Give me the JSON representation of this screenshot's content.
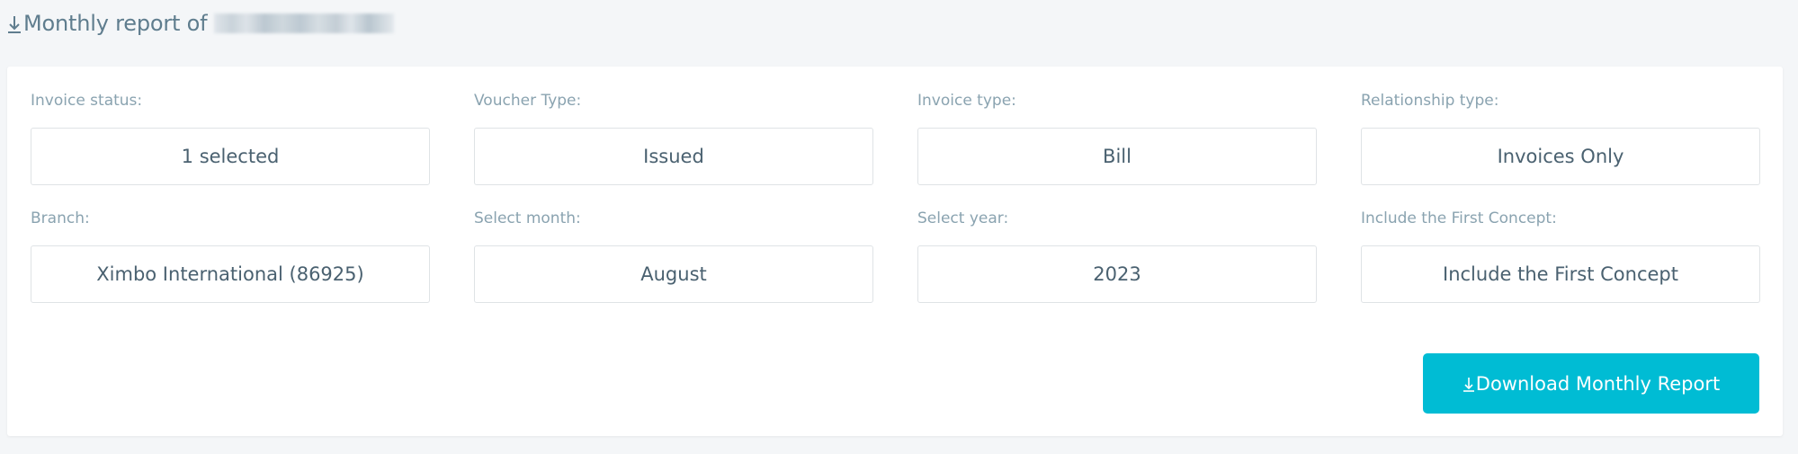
{
  "header": {
    "title": "Monthly report of",
    "title_icon": "download-icon",
    "redacted_name": ""
  },
  "filters": [
    {
      "label": "Invoice status:",
      "value": "1 selected"
    },
    {
      "label": "Voucher Type:",
      "value": "Issued"
    },
    {
      "label": "Invoice type:",
      "value": "Bill"
    },
    {
      "label": "Relationship type:",
      "value": "Invoices Only"
    },
    {
      "label": "Branch:",
      "value": "Ximbo International (86925)"
    },
    {
      "label": "Select month:",
      "value": "August"
    },
    {
      "label": "Select year:",
      "value": "2023"
    },
    {
      "label": "Include the First Concept:",
      "value": "Include the First Concept"
    }
  ],
  "actions": {
    "download_label": "Download Monthly Report",
    "download_icon": "download-icon"
  },
  "colors": {
    "accent": "#00bcd4",
    "title_text": "#5f7d8e",
    "label_text": "#8aa3b0",
    "value_text": "#4a6170",
    "background": "#f4f6f8"
  }
}
